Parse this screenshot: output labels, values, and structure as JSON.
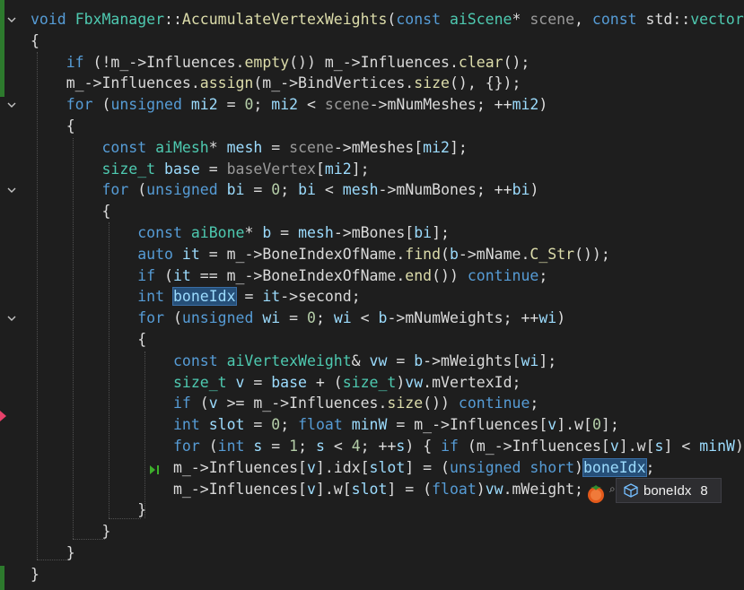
{
  "editor": {
    "lines": [
      [
        {
          "t": "void",
          "c": "kw"
        },
        {
          "t": " "
        },
        {
          "t": "FbxManager",
          "c": "ty"
        },
        {
          "t": "::"
        },
        {
          "t": "AccumulateVertexWeights",
          "c": "fn"
        },
        {
          "t": "("
        },
        {
          "t": "const",
          "c": "kw"
        },
        {
          "t": " "
        },
        {
          "t": "aiScene",
          "c": "ty"
        },
        {
          "t": "* "
        },
        {
          "t": "scene",
          "c": "pa"
        },
        {
          "t": ", "
        },
        {
          "t": "const",
          "c": "kw"
        },
        {
          "t": " std::"
        },
        {
          "t": "vector",
          "c": "ty"
        }
      ],
      [
        {
          "t": "{"
        }
      ],
      [
        {
          "t": "    "
        },
        {
          "t": "if",
          "c": "kw"
        },
        {
          "t": " (!m_->"
        },
        {
          "t": "Influences",
          "c": "pr"
        },
        {
          "t": "."
        },
        {
          "t": "empty",
          "c": "fn"
        },
        {
          "t": "()) m_->"
        },
        {
          "t": "Influences",
          "c": "pr"
        },
        {
          "t": "."
        },
        {
          "t": "clear",
          "c": "fn"
        },
        {
          "t": "();"
        }
      ],
      [
        {
          "t": "    m_->"
        },
        {
          "t": "Influences",
          "c": "pr"
        },
        {
          "t": "."
        },
        {
          "t": "assign",
          "c": "fn"
        },
        {
          "t": "(m_->"
        },
        {
          "t": "BindVertices",
          "c": "pr"
        },
        {
          "t": "."
        },
        {
          "t": "size",
          "c": "fn"
        },
        {
          "t": "(), {});"
        }
      ],
      [
        {
          "t": "    "
        },
        {
          "t": "for",
          "c": "kw"
        },
        {
          "t": " ("
        },
        {
          "t": "unsigned",
          "c": "kw"
        },
        {
          "t": " "
        },
        {
          "t": "mi2",
          "c": "lo"
        },
        {
          "t": " = "
        },
        {
          "t": "0",
          "c": "nu"
        },
        {
          "t": "; "
        },
        {
          "t": "mi2",
          "c": "lo"
        },
        {
          "t": " < "
        },
        {
          "t": "scene",
          "c": "pa"
        },
        {
          "t": "->"
        },
        {
          "t": "mNumMeshes",
          "c": "pr"
        },
        {
          "t": "; ++"
        },
        {
          "t": "mi2",
          "c": "lo"
        },
        {
          "t": ")"
        }
      ],
      [
        {
          "t": "    {"
        }
      ],
      [
        {
          "t": "        "
        },
        {
          "t": "const",
          "c": "kw"
        },
        {
          "t": " "
        },
        {
          "t": "aiMesh",
          "c": "ty"
        },
        {
          "t": "* "
        },
        {
          "t": "mesh",
          "c": "lo"
        },
        {
          "t": " = "
        },
        {
          "t": "scene",
          "c": "pa"
        },
        {
          "t": "->"
        },
        {
          "t": "mMeshes",
          "c": "pr"
        },
        {
          "t": "["
        },
        {
          "t": "mi2",
          "c": "lo"
        },
        {
          "t": "];"
        }
      ],
      [
        {
          "t": "        "
        },
        {
          "t": "size_t",
          "c": "ty"
        },
        {
          "t": " "
        },
        {
          "t": "base",
          "c": "lo"
        },
        {
          "t": " = "
        },
        {
          "t": "baseVertex",
          "c": "pa"
        },
        {
          "t": "["
        },
        {
          "t": "mi2",
          "c": "lo"
        },
        {
          "t": "];"
        }
      ],
      [
        {
          "t": "        "
        },
        {
          "t": "for",
          "c": "kw"
        },
        {
          "t": " ("
        },
        {
          "t": "unsigned",
          "c": "kw"
        },
        {
          "t": " "
        },
        {
          "t": "bi",
          "c": "lo"
        },
        {
          "t": " = "
        },
        {
          "t": "0",
          "c": "nu"
        },
        {
          "t": "; "
        },
        {
          "t": "bi",
          "c": "lo"
        },
        {
          "t": " < "
        },
        {
          "t": "mesh",
          "c": "lo"
        },
        {
          "t": "->"
        },
        {
          "t": "mNumBones",
          "c": "pr"
        },
        {
          "t": "; ++"
        },
        {
          "t": "bi",
          "c": "lo"
        },
        {
          "t": ")"
        }
      ],
      [
        {
          "t": "        {"
        }
      ],
      [
        {
          "t": "            "
        },
        {
          "t": "const",
          "c": "kw"
        },
        {
          "t": " "
        },
        {
          "t": "aiBone",
          "c": "ty"
        },
        {
          "t": "* "
        },
        {
          "t": "b",
          "c": "lo"
        },
        {
          "t": " = "
        },
        {
          "t": "mesh",
          "c": "lo"
        },
        {
          "t": "->"
        },
        {
          "t": "mBones",
          "c": "pr"
        },
        {
          "t": "["
        },
        {
          "t": "bi",
          "c": "lo"
        },
        {
          "t": "];"
        }
      ],
      [
        {
          "t": "            "
        },
        {
          "t": "auto",
          "c": "kw"
        },
        {
          "t": " "
        },
        {
          "t": "it",
          "c": "lo"
        },
        {
          "t": " = m_->"
        },
        {
          "t": "BoneIndexOfName",
          "c": "pr"
        },
        {
          "t": "."
        },
        {
          "t": "find",
          "c": "fn"
        },
        {
          "t": "("
        },
        {
          "t": "b",
          "c": "lo"
        },
        {
          "t": "->"
        },
        {
          "t": "mName",
          "c": "pr"
        },
        {
          "t": "."
        },
        {
          "t": "C_Str",
          "c": "fn"
        },
        {
          "t": "());"
        }
      ],
      [
        {
          "t": "            "
        },
        {
          "t": "if",
          "c": "kw"
        },
        {
          "t": " ("
        },
        {
          "t": "it",
          "c": "lo"
        },
        {
          "t": " == m_->"
        },
        {
          "t": "BoneIndexOfName",
          "c": "pr"
        },
        {
          "t": "."
        },
        {
          "t": "end",
          "c": "fn"
        },
        {
          "t": "()) "
        },
        {
          "t": "continue",
          "c": "kw"
        },
        {
          "t": ";"
        }
      ],
      [
        {
          "t": "            "
        },
        {
          "t": "int",
          "c": "kw"
        },
        {
          "t": " "
        },
        {
          "t": "boneIdx",
          "c": "lo hl-ref"
        },
        {
          "t": " = "
        },
        {
          "t": "it",
          "c": "lo"
        },
        {
          "t": "->"
        },
        {
          "t": "second",
          "c": "pr"
        },
        {
          "t": ";"
        }
      ],
      [
        {
          "t": "            "
        },
        {
          "t": "for",
          "c": "kw"
        },
        {
          "t": " ("
        },
        {
          "t": "unsigned",
          "c": "kw"
        },
        {
          "t": " "
        },
        {
          "t": "wi",
          "c": "lo"
        },
        {
          "t": " = "
        },
        {
          "t": "0",
          "c": "nu"
        },
        {
          "t": "; "
        },
        {
          "t": "wi",
          "c": "lo"
        },
        {
          "t": " < "
        },
        {
          "t": "b",
          "c": "lo"
        },
        {
          "t": "->"
        },
        {
          "t": "mNumWeights",
          "c": "pr"
        },
        {
          "t": "; ++"
        },
        {
          "t": "wi",
          "c": "lo"
        },
        {
          "t": ")"
        }
      ],
      [
        {
          "t": "            {"
        }
      ],
      [
        {
          "t": "                "
        },
        {
          "t": "const",
          "c": "kw"
        },
        {
          "t": " "
        },
        {
          "t": "aiVertexWeight",
          "c": "ty"
        },
        {
          "t": "& "
        },
        {
          "t": "vw",
          "c": "lo"
        },
        {
          "t": " = "
        },
        {
          "t": "b",
          "c": "lo"
        },
        {
          "t": "->"
        },
        {
          "t": "mWeights",
          "c": "pr"
        },
        {
          "t": "["
        },
        {
          "t": "wi",
          "c": "lo"
        },
        {
          "t": "];"
        }
      ],
      [
        {
          "t": "                "
        },
        {
          "t": "size_t",
          "c": "ty"
        },
        {
          "t": " "
        },
        {
          "t": "v",
          "c": "lo"
        },
        {
          "t": " = "
        },
        {
          "t": "base",
          "c": "lo"
        },
        {
          "t": " + ("
        },
        {
          "t": "size_t",
          "c": "ty"
        },
        {
          "t": ")"
        },
        {
          "t": "vw",
          "c": "lo"
        },
        {
          "t": "."
        },
        {
          "t": "mVertexId",
          "c": "pr"
        },
        {
          "t": ";"
        }
      ],
      [
        {
          "t": "                "
        },
        {
          "t": "if",
          "c": "kw"
        },
        {
          "t": " ("
        },
        {
          "t": "v",
          "c": "lo"
        },
        {
          "t": " >= m_->"
        },
        {
          "t": "Influences",
          "c": "pr"
        },
        {
          "t": "."
        },
        {
          "t": "size",
          "c": "fn"
        },
        {
          "t": "()) "
        },
        {
          "t": "continue",
          "c": "kw"
        },
        {
          "t": ";"
        }
      ],
      [
        {
          "t": "                "
        },
        {
          "t": "int",
          "c": "kw"
        },
        {
          "t": " "
        },
        {
          "t": "slot",
          "c": "lo"
        },
        {
          "t": " = "
        },
        {
          "t": "0",
          "c": "nu"
        },
        {
          "t": "; "
        },
        {
          "t": "float",
          "c": "kw"
        },
        {
          "t": " "
        },
        {
          "t": "minW",
          "c": "lo"
        },
        {
          "t": " = m_->"
        },
        {
          "t": "Influences",
          "c": "pr"
        },
        {
          "t": "["
        },
        {
          "t": "v",
          "c": "lo"
        },
        {
          "t": "]."
        },
        {
          "t": "w",
          "c": "pr"
        },
        {
          "t": "["
        },
        {
          "t": "0",
          "c": "nu"
        },
        {
          "t": "];"
        }
      ],
      [
        {
          "t": "                "
        },
        {
          "t": "for",
          "c": "kw"
        },
        {
          "t": " ("
        },
        {
          "t": "int",
          "c": "kw"
        },
        {
          "t": " "
        },
        {
          "t": "s",
          "c": "lo"
        },
        {
          "t": " = "
        },
        {
          "t": "1",
          "c": "nu"
        },
        {
          "t": "; "
        },
        {
          "t": "s",
          "c": "lo"
        },
        {
          "t": " < "
        },
        {
          "t": "4",
          "c": "nu"
        },
        {
          "t": "; ++"
        },
        {
          "t": "s",
          "c": "lo"
        },
        {
          "t": ") { "
        },
        {
          "t": "if",
          "c": "kw"
        },
        {
          "t": " (m_->"
        },
        {
          "t": "Influences",
          "c": "pr"
        },
        {
          "t": "["
        },
        {
          "t": "v",
          "c": "lo"
        },
        {
          "t": "]."
        },
        {
          "t": "w",
          "c": "pr"
        },
        {
          "t": "["
        },
        {
          "t": "s",
          "c": "lo"
        },
        {
          "t": "] < "
        },
        {
          "t": "minW",
          "c": "lo"
        },
        {
          "t": ")"
        }
      ],
      [
        {
          "t": "                m_->"
        },
        {
          "t": "Influences",
          "c": "pr"
        },
        {
          "t": "["
        },
        {
          "t": "v",
          "c": "lo"
        },
        {
          "t": "]."
        },
        {
          "t": "idx",
          "c": "pr"
        },
        {
          "t": "["
        },
        {
          "t": "slot",
          "c": "lo"
        },
        {
          "t": "] = ("
        },
        {
          "t": "unsigned",
          "c": "kw"
        },
        {
          "t": " "
        },
        {
          "t": "short",
          "c": "kw"
        },
        {
          "t": ")"
        },
        {
          "t": "boneIdx",
          "c": "lo hl-sel"
        },
        {
          "t": ";"
        }
      ],
      [
        {
          "t": "                m_->"
        },
        {
          "t": "Influences",
          "c": "pr"
        },
        {
          "t": "["
        },
        {
          "t": "v",
          "c": "lo"
        },
        {
          "t": "]."
        },
        {
          "t": "w",
          "c": "pr"
        },
        {
          "t": "["
        },
        {
          "t": "slot",
          "c": "lo"
        },
        {
          "t": "] = ("
        },
        {
          "t": "float",
          "c": "kw"
        },
        {
          "t": ")"
        },
        {
          "t": "vw",
          "c": "lo"
        },
        {
          "t": "."
        },
        {
          "t": "mWeight",
          "c": "pr"
        },
        {
          "t": ";"
        }
      ],
      [
        {
          "t": "            }"
        }
      ],
      [
        {
          "t": "        }"
        }
      ],
      [
        {
          "t": "    }"
        }
      ],
      [
        {
          "t": "}"
        }
      ]
    ]
  },
  "datatip": {
    "name": "boneIdx",
    "value": "8",
    "pin_glyph": "⌕"
  },
  "colors": {
    "background": "#1e1e1e",
    "keyword": "#569cd6",
    "type": "#4ec9b0",
    "function": "#dcdcaa",
    "local": "#9cdcfe",
    "change_bar": "#2d7a2d",
    "breakpoint_arrow": "#e8416a"
  },
  "icons": [
    "fold-chevron-icon",
    "run-to-click-icon",
    "copilot-bear-icon",
    "cube-variable-icon",
    "pin-icon",
    "breakpoint-arrow-icon"
  ]
}
